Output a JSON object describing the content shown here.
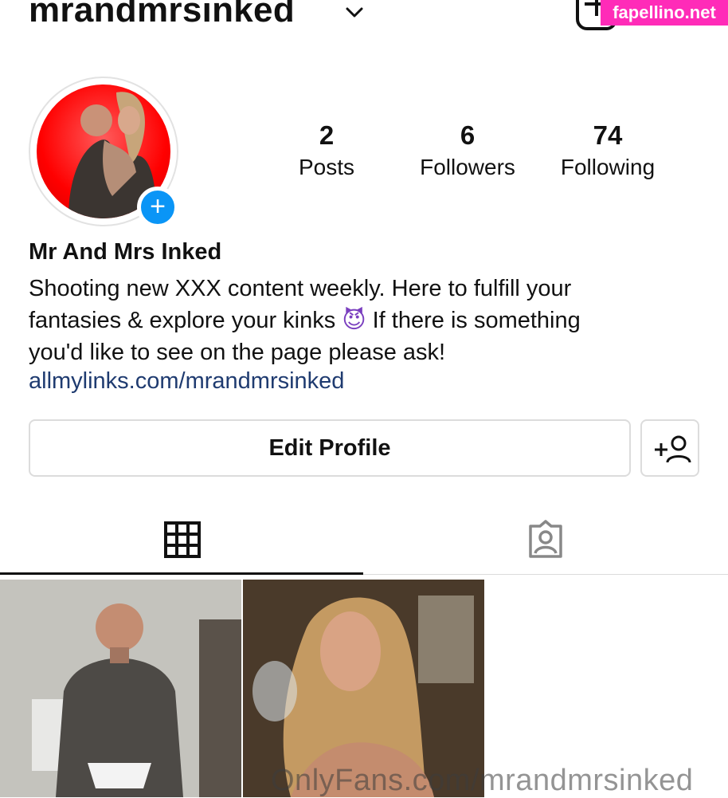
{
  "header": {
    "username": "mrandmrsinked",
    "watermark": "fapellino.net"
  },
  "stats": {
    "posts": {
      "count": "2",
      "label": "Posts"
    },
    "followers": {
      "count": "6",
      "label": "Followers"
    },
    "following": {
      "count": "74",
      "label": "Following"
    }
  },
  "profile": {
    "display_name": "Mr And Mrs Inked",
    "bio_line1": "Shooting new XXX content weekly. Here to fulfill your",
    "bio_line2_a": "fantasies & explore your kinks",
    "bio_emoji": "😈",
    "bio_line2_b": "If there is something",
    "bio_line3": "you'd like to see on the page please ask!",
    "link": "allmylinks.com/mrandmrsinked"
  },
  "actions": {
    "edit_profile": "Edit Profile"
  },
  "tabs": [
    {
      "name": "grid",
      "icon": "grid-icon",
      "selected": true
    },
    {
      "name": "tagged",
      "icon": "tagged-person-icon",
      "selected": false
    }
  ],
  "overlay": {
    "watermark_bottom": "OnlyFans.com/mrandmrsinked"
  },
  "colors": {
    "accent_blue": "#0a95f6",
    "link": "#1f3b70",
    "avatar_bg": "#ff0000",
    "watermark_bg": "#ff2bb8"
  }
}
